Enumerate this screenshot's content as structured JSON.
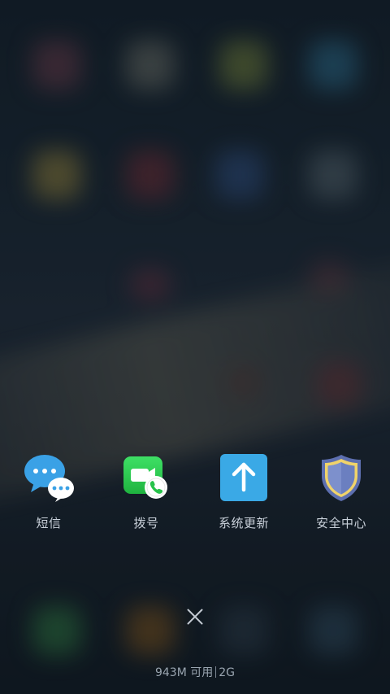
{
  "recent_apps": [
    {
      "label": "短信",
      "icon": "messages-icon"
    },
    {
      "label": "拨号",
      "icon": "dialer-icon"
    },
    {
      "label": "系统更新",
      "icon": "system-update-icon"
    },
    {
      "label": "安全中心",
      "icon": "security-center-icon"
    }
  ],
  "memory": {
    "available": "943M 可用",
    "network": "2G"
  },
  "colors": {
    "messages_blue": "#3aa1e6",
    "dialer_green": "#27c24a",
    "update_blue": "#3aa9e6",
    "shield_fill": "#6b7fc0",
    "shield_border": "#f0d36a",
    "label_text": "#c9d1da"
  }
}
